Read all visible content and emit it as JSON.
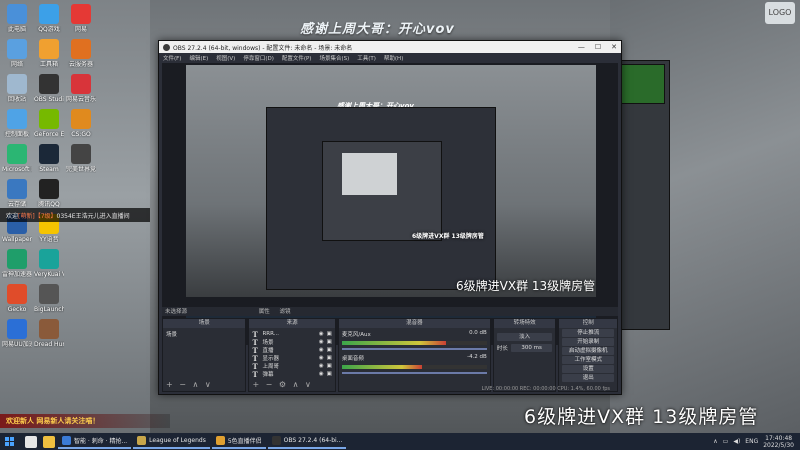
{
  "banner": {
    "title": "感谢上周大哥：开心vov",
    "corner_logo": "LOGO"
  },
  "desktop_icons_col1": [
    {
      "label": "此电脑",
      "color": "#4a90d9"
    },
    {
      "label": "网络",
      "color": "#5aa0e0"
    },
    {
      "label": "回收站",
      "color": "#9fb8cf"
    },
    {
      "label": "控制面板",
      "color": "#4fa3e6"
    },
    {
      "label": "Microsoft Edge",
      "color": "#2bb673"
    },
    {
      "label": "云存储",
      "color": "#3a78c0"
    },
    {
      "label": "Wallpaper Engine",
      "color": "#2a5fa8"
    },
    {
      "label": "雷神加速器",
      "color": "#1f9e6a"
    },
    {
      "label": "Gecko",
      "color": "#e04c2a"
    },
    {
      "label": "网易UU加速器",
      "color": "#2b6fd6"
    }
  ],
  "desktop_icons_col2": [
    {
      "label": "QQ游戏",
      "color": "#3ca0e8"
    },
    {
      "label": "工具箱",
      "color": "#f0a030"
    },
    {
      "label": "OBS Studio",
      "color": "#333333"
    },
    {
      "label": "GeForce Experience",
      "color": "#76b900"
    },
    {
      "label": "Steam",
      "color": "#1b2838"
    },
    {
      "label": "腾讯QQ",
      "color": "#222222"
    },
    {
      "label": "YY语音",
      "color": "#f5c400"
    },
    {
      "label": "VeryKuai VX",
      "color": "#1aa39a"
    },
    {
      "label": "BigLaunch",
      "color": "#555555"
    },
    {
      "label": "Dread Hunger",
      "color": "#8a5a3a"
    }
  ],
  "desktop_icons_col3": [
    {
      "label": "网易",
      "color": "#e53935"
    },
    {
      "label": "云服务器",
      "color": "#e07020"
    },
    {
      "label": "网易云音乐",
      "color": "#d8343a"
    },
    {
      "label": "CS:GO",
      "color": "#e08a1e"
    },
    {
      "label": "完美世界竞技",
      "color": "#444444"
    }
  ],
  "chat": {
    "prefix": "欢迎",
    "user": "[萌新]",
    "level": "【7级】",
    "text": "0354E王浩元儿进入直播间"
  },
  "welcome": "欢迎新人 网易新人请关注喵！",
  "obs": {
    "title": "OBS 27.2.4 (64-bit, windows) - 配置文件: 未命名 - 场景: 未命名",
    "menu": [
      "文件(F)",
      "编辑(E)",
      "视图(V)",
      "停靠窗口(D)",
      "配置文件(P)",
      "场景集合(S)",
      "工具(T)",
      "帮助(H)"
    ],
    "nested_banner": "感谢上周大哥：开心vov",
    "nested_caption_small": "6级牌进VX群 13级牌房管",
    "no_source": "未选择源",
    "tabs": [
      "属性",
      "滤镜"
    ],
    "docks": {
      "scenes": {
        "header": "场景",
        "items": [
          "场景"
        ]
      },
      "sources": {
        "header": "来源",
        "items": [
          "RRR...",
          "场景",
          "直播",
          "显示器",
          "上周哥",
          "弹幕"
        ]
      },
      "mixer": {
        "header": "混音器",
        "tracks": [
          {
            "name": "麦克风/Aux",
            "db": "0.0 dB",
            "level": 0.72
          },
          {
            "name": "桌面音频",
            "db": "-4.2 dB",
            "level": 0.55
          }
        ]
      },
      "transitions": {
        "header": "转场特效",
        "type": "淡入",
        "duration_label": "时长",
        "duration": "300 ms"
      },
      "controls": {
        "header": "控制",
        "buttons": [
          "停止推流",
          "开始录制",
          "启动虚拟摄像机",
          "工作室模式",
          "设置",
          "退出"
        ]
      }
    },
    "status": "LIVE: 00:00:00  REC: 00:00:00  CPU: 1.4%, 60.00 fps"
  },
  "captions": {
    "mid": "6级牌进VX群  13级牌房管",
    "big": "6级牌进VX群  13级牌房管"
  },
  "taskbar": {
    "apps": [
      {
        "label": "智能 · 刺命 · 精抢...",
        "color": "#3b7bd6"
      },
      {
        "label": "League of Legends",
        "color": "#c8a64a"
      },
      {
        "label": "5色直播伴侣",
        "color": "#e0a030"
      },
      {
        "label": "OBS 27.2.4 (64-bi...",
        "color": "#333333"
      }
    ],
    "lang": "ENG",
    "time": "17:40:48",
    "date": "2022/5/30"
  }
}
